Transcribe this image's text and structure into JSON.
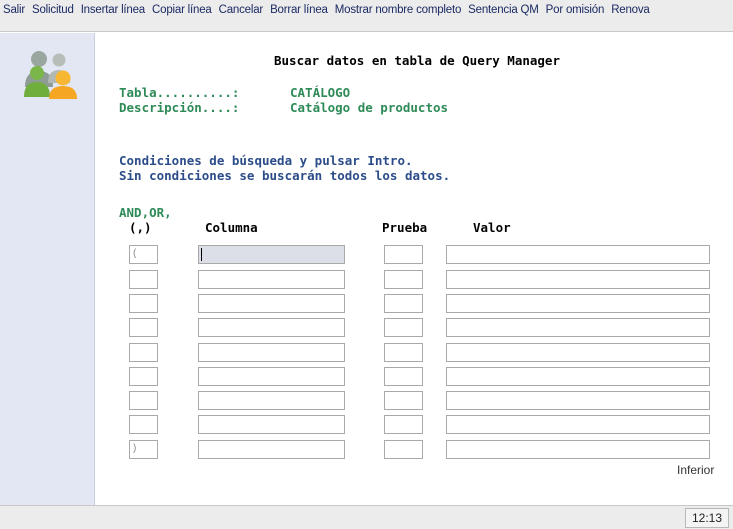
{
  "menu": {
    "items": [
      "Salir",
      "Solicitud",
      "Insertar línea",
      "Copiar línea",
      "Cancelar",
      "Borrar línea",
      "Mostrar nombre completo",
      "Sentencia QM",
      "Por omisión",
      "Renova"
    ]
  },
  "screen": {
    "title": "Buscar datos en tabla de Query Manager",
    "tabla_label": "Tabla..........:",
    "tabla_value": "CATÁLOGO",
    "descripcion_label": "Descripción....:",
    "descripcion_value": "Catálogo de productos",
    "instruction_1": "Condiciones de búsqueda y pulsar Intro.",
    "instruction_2": "Sin condiciones se buscarán todos los datos."
  },
  "grid": {
    "andor_header": "AND,OR,",
    "paren_header": "(,)",
    "columna_header": "Columna",
    "prueba_header": "Prueba",
    "valor_header": "Valor",
    "rows": [
      {
        "connector": "(",
        "columna": "",
        "prueba": "",
        "valor": ""
      },
      {
        "connector": "",
        "columna": "",
        "prueba": "",
        "valor": ""
      },
      {
        "connector": "",
        "columna": "",
        "prueba": "",
        "valor": ""
      },
      {
        "connector": "",
        "columna": "",
        "prueba": "",
        "valor": ""
      },
      {
        "connector": "",
        "columna": "",
        "prueba": "",
        "valor": ""
      },
      {
        "connector": "",
        "columna": "",
        "prueba": "",
        "valor": ""
      },
      {
        "connector": "",
        "columna": "",
        "prueba": "",
        "valor": ""
      },
      {
        "connector": "",
        "columna": "",
        "prueba": "",
        "valor": ""
      },
      {
        "connector": ")",
        "columna": "",
        "prueba": "",
        "valor": ""
      }
    ],
    "more_indicator": "Inferior"
  },
  "status": {
    "time": "12:13"
  },
  "icons": {
    "sidebar": "users-icon"
  }
}
